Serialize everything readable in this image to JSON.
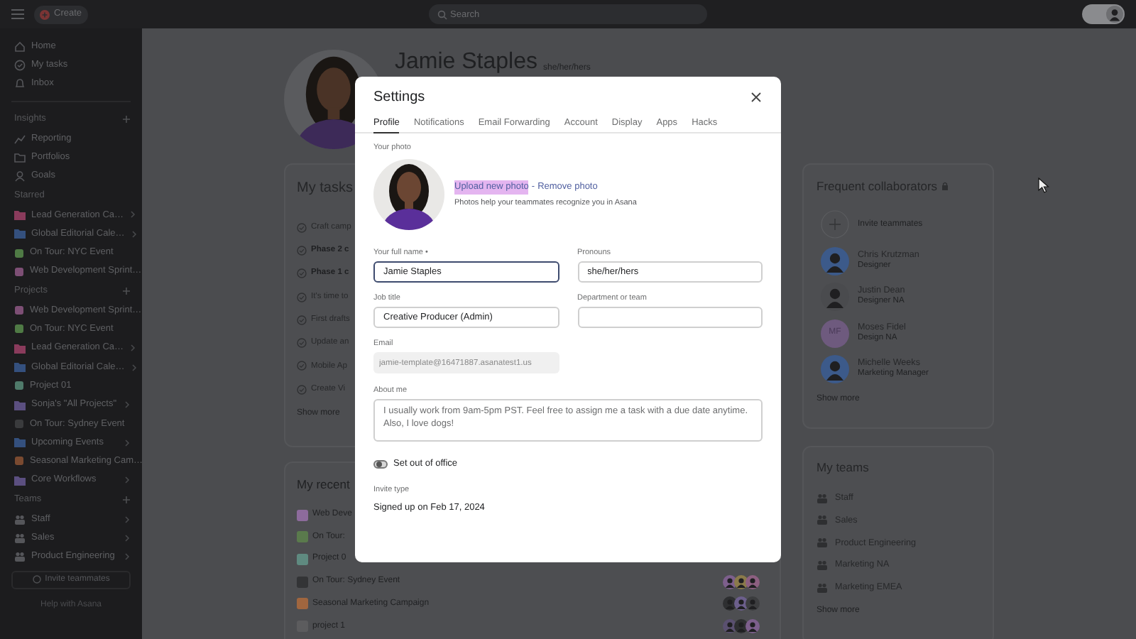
{
  "top_bar": {
    "create_button": "Create",
    "search": {
      "placeholder": "Search"
    }
  },
  "sidebar": {
    "nav": [
      {
        "label": "Home",
        "kind": "home"
      },
      {
        "label": "My tasks",
        "kind": "check"
      },
      {
        "label": "Inbox",
        "kind": "bell"
      }
    ],
    "sections": [
      {
        "title": "Insights",
        "add_button": true,
        "items": [
          {
            "label": "Reporting",
            "kind": "chart"
          },
          {
            "label": "Portfolios",
            "kind": "folder-outline"
          },
          {
            "label": "Goals",
            "kind": "person"
          }
        ]
      },
      {
        "title": "Starred",
        "add_button": false,
        "items": [
          {
            "label": "Lead Generation Ca…",
            "kind": "portfolio",
            "color": "#8a3b5c"
          },
          {
            "label": "Global Editorial Cale…",
            "kind": "portfolio",
            "color": "#34507e"
          },
          {
            "label": "On Tour: NYC Event",
            "kind": "project",
            "color": "#4f7a45"
          },
          {
            "label": "Web Development Sprint…",
            "kind": "project",
            "color": "#7d4f75"
          }
        ]
      },
      {
        "title": "Projects",
        "add_button": true,
        "items": [
          {
            "label": "Web Development Sprint…",
            "kind": "project",
            "color": "#7d4f75"
          },
          {
            "label": "On Tour: NYC Event",
            "kind": "project",
            "color": "#4f7a45"
          },
          {
            "label": "Lead Generation Ca…",
            "kind": "portfolio",
            "color": "#8a3b5c"
          },
          {
            "label": "Global Editorial Cale…",
            "kind": "portfolio",
            "color": "#34507e"
          },
          {
            "label": "Project 01",
            "kind": "project",
            "color": "#4f7a6a"
          },
          {
            "label": "Sonja's \"All Projects\"",
            "kind": "portfolio",
            "color": "#5b4f80"
          },
          {
            "label": "On Tour: Sydney Event",
            "kind": "project",
            "color": "#3a3b3d"
          },
          {
            "label": "Upcoming Events",
            "kind": "portfolio",
            "color": "#34507e"
          },
          {
            "label": "Seasonal Marketing Cam…",
            "kind": "project",
            "color": "#7a4a30"
          },
          {
            "label": "Core Workflows",
            "kind": "portfolio",
            "color": "#5b4f80"
          }
        ]
      },
      {
        "title": "Teams",
        "add_button": true,
        "items": [
          {
            "label": "Staff",
            "kind": "team"
          },
          {
            "label": "Sales",
            "kind": "team"
          },
          {
            "label": "Product Engineering",
            "kind": "team"
          }
        ]
      }
    ],
    "invite_button": "Invite teammates",
    "help_link": "Help with Asana"
  },
  "profile_header": {
    "name": "Jamie Staples",
    "pronouns": "she/her/hers"
  },
  "my_tasks": {
    "title": "My tasks",
    "tasks": [
      {
        "label": "Craft camp",
        "bold": false
      },
      {
        "label": "Phase 2 c",
        "bold": true
      },
      {
        "label": "Phase 1 c",
        "bold": true
      },
      {
        "label": "It's time to",
        "bold": false
      },
      {
        "label": "First drafts",
        "bold": false
      },
      {
        "label": "Update an",
        "bold": false
      },
      {
        "label": "Mobile Ap",
        "bold": false
      },
      {
        "label": "Create Vi",
        "bold": false
      }
    ],
    "show_more": "Show more"
  },
  "recent_projects": {
    "title": "My recent",
    "projects": [
      {
        "label": "Web Deve",
        "color": "#8d6b9c"
      },
      {
        "label": "On Tour:",
        "color": "#5a7a4c"
      },
      {
        "label": "Project 0",
        "color": "#5f8a80"
      },
      {
        "label": "On Tour: Sydney Event",
        "color": "#333436",
        "avatars": [
          {
            "color": "#7d5f8c"
          },
          {
            "color": "#8a7a4a"
          },
          {
            "color": "#8c5f80"
          }
        ]
      },
      {
        "label": "Seasonal Marketing Campaign",
        "color": "#a0663f",
        "avatars": [
          {
            "color": "#2e2f31"
          },
          {
            "color": "#6c5f8c"
          },
          {
            "color": "#3c3d3f"
          }
        ]
      },
      {
        "label": "project 1",
        "color": "#5c5c5e",
        "avatars": [
          {
            "color": "#5a5070"
          },
          {
            "color": "#2e2f31"
          },
          {
            "color": "#7d5f8c"
          }
        ]
      }
    ]
  },
  "collaborators": {
    "title": "Frequent collaborators",
    "invite": "Invite teammates",
    "people": [
      {
        "name": "Chris Krutzman",
        "role": "Designer"
      },
      {
        "name": "Justin Dean",
        "role": "Designer NA"
      },
      {
        "name": "Moses Fidel",
        "role": "Design NA",
        "kind": "initials",
        "initials": "MF"
      },
      {
        "name": "Michelle Weeks",
        "role": "Marketing Manager"
      }
    ],
    "show_more": "Show more"
  },
  "teams": {
    "title": "My teams",
    "items": [
      "Staff",
      "Sales",
      "Product Engineering",
      "Marketing NA",
      "Marketing EMEA"
    ],
    "show_more": "Show more"
  },
  "settings_dialog": {
    "title": "Settings",
    "tabs": [
      {
        "label": "Profile",
        "selected": true
      },
      {
        "label": "Notifications",
        "selected": false
      },
      {
        "label": "Email Forwarding",
        "selected": false
      },
      {
        "label": "Account",
        "selected": false
      },
      {
        "label": "Display",
        "selected": false
      },
      {
        "label": "Apps",
        "selected": false
      },
      {
        "label": "Hacks",
        "selected": false
      }
    ],
    "photo": {
      "label": "Your photo",
      "upload_link": "Upload new photo",
      "upload_highlighted": true,
      "separator": "-",
      "remove_link": "Remove photo",
      "hint": "Photos help your teammates recognize you in Asana"
    },
    "fields": [
      {
        "label": "Your full name •",
        "kind": "input",
        "value": "Jamie Staples",
        "focused": true,
        "disabled": false
      },
      {
        "label": "Pronouns",
        "kind": "input",
        "value": "she/her/hers",
        "focused": false,
        "disabled": false
      },
      {
        "label": "Job title",
        "kind": "input",
        "value": "Creative Producer (Admin)",
        "focused": false,
        "disabled": false
      },
      {
        "label": "Department or team",
        "kind": "input",
        "focused": false,
        "disabled": false
      },
      {
        "label": "Email",
        "kind": "input",
        "value": "jamie-template@16471887.asanatest1.us",
        "focused": false,
        "disabled": true
      },
      {
        "label": "About me",
        "kind": "textarea",
        "value": "I usually work from 9am-5pm PST. Feel free to assign me a task with a due date anytime. Also, I love dogs!",
        "focused": false,
        "disabled": false
      }
    ],
    "out_of_office": {
      "label": "Set out of office",
      "on": false
    },
    "invite_type": {
      "label": "Invite type",
      "value": "Signed up on Feb 17, 2024"
    }
  }
}
